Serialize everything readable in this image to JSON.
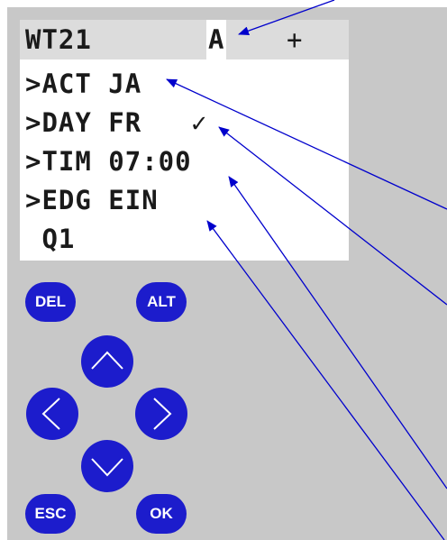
{
  "display": {
    "header": {
      "title": "WT21",
      "tab_a": "A",
      "tab_plus": "+"
    },
    "lines": [
      {
        "text": ">ACT JA"
      },
      {
        "text": ">DAY FR"
      },
      {
        "text": ">TIM 07:00"
      },
      {
        "text": ">EDG EIN"
      },
      {
        "text": " Q1"
      }
    ],
    "checkmark": "✓"
  },
  "buttons": {
    "del": "DEL",
    "alt": "ALT",
    "esc": "ESC",
    "ok": "OK"
  },
  "colors": {
    "device_body": "#c8c8c8",
    "lcd_background": "#ffffff",
    "lcd_header": "#dcdcdc",
    "button": "#1c1ccc",
    "annotation_line": "#0000cc"
  }
}
